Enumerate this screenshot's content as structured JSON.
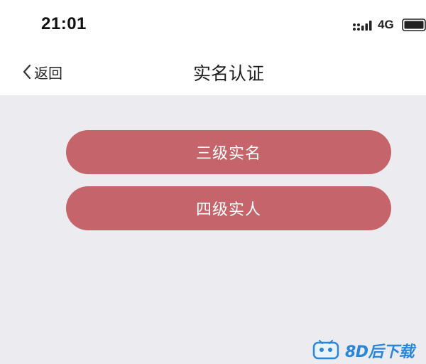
{
  "status_bar": {
    "time": "21:01",
    "network": "4G",
    "icons": [
      "signal-icon",
      "battery-icon"
    ]
  },
  "nav": {
    "back_label": "返回",
    "title": "实名认证",
    "icons": [
      "chevron-left-icon"
    ]
  },
  "options": [
    {
      "label": "三级实名"
    },
    {
      "label": "四级实人"
    }
  ],
  "watermark": {
    "text": "8D后下载",
    "icon": "tv-logo-icon"
  },
  "colors": {
    "button": "#C6646B",
    "background": "#ECEBEF",
    "header": "#FFFFFF",
    "watermark": "#2A86D9"
  }
}
